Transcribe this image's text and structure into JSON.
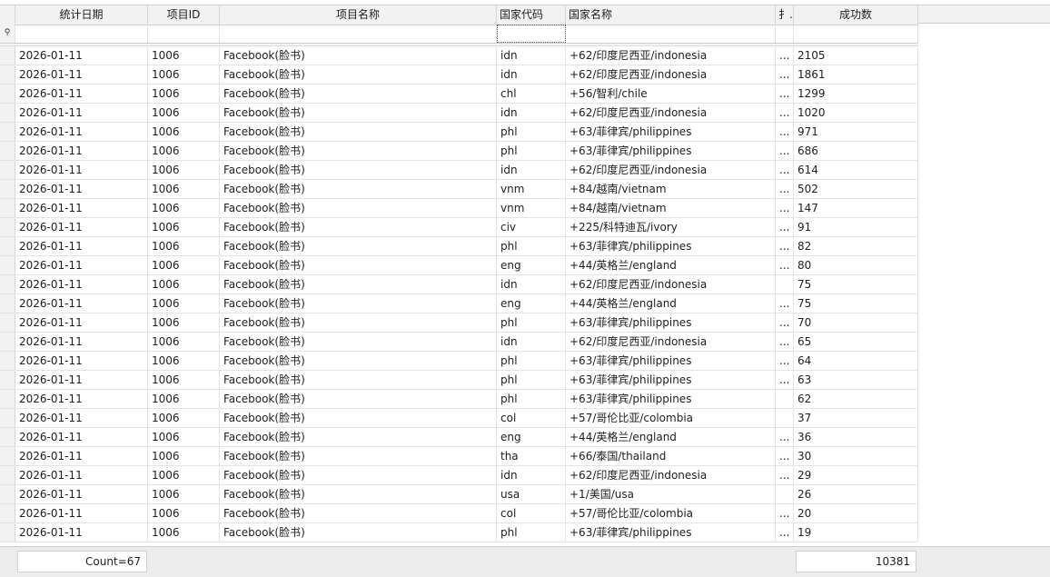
{
  "columns": {
    "date": "统计日期",
    "project_id": "项目ID",
    "project_name": "项目名称",
    "country_code": "国家代码",
    "country_name": "国家名称",
    "truncated": "扌..",
    "success_count": "成功数"
  },
  "filter_row": {
    "indicator": "⚲"
  },
  "rows": [
    {
      "date": "2026-01-11",
      "pid": "1006",
      "name": "Facebook(脸书)",
      "code": "idn",
      "cname": "+62/印度尼西亚/indonesia",
      "t": "...",
      "count": "2105"
    },
    {
      "date": "2026-01-11",
      "pid": "1006",
      "name": "Facebook(脸书)",
      "code": "idn",
      "cname": "+62/印度尼西亚/indonesia",
      "t": "...",
      "count": "1861"
    },
    {
      "date": "2026-01-11",
      "pid": "1006",
      "name": "Facebook(脸书)",
      "code": "chl",
      "cname": "+56/智利/chile",
      "t": "...",
      "count": "1299"
    },
    {
      "date": "2026-01-11",
      "pid": "1006",
      "name": "Facebook(脸书)",
      "code": "idn",
      "cname": "+62/印度尼西亚/indonesia",
      "t": "...",
      "count": "1020"
    },
    {
      "date": "2026-01-11",
      "pid": "1006",
      "name": "Facebook(脸书)",
      "code": "phl",
      "cname": "+63/菲律宾/philippines",
      "t": "...",
      "count": "971"
    },
    {
      "date": "2026-01-11",
      "pid": "1006",
      "name": "Facebook(脸书)",
      "code": "phl",
      "cname": "+63/菲律宾/philippines",
      "t": "...",
      "count": "686"
    },
    {
      "date": "2026-01-11",
      "pid": "1006",
      "name": "Facebook(脸书)",
      "code": "idn",
      "cname": "+62/印度尼西亚/indonesia",
      "t": "...",
      "count": "614"
    },
    {
      "date": "2026-01-11",
      "pid": "1006",
      "name": "Facebook(脸书)",
      "code": "vnm",
      "cname": "+84/越南/vietnam",
      "t": "...",
      "count": "502"
    },
    {
      "date": "2026-01-11",
      "pid": "1006",
      "name": "Facebook(脸书)",
      "code": "vnm",
      "cname": "+84/越南/vietnam",
      "t": "...",
      "count": "147"
    },
    {
      "date": "2026-01-11",
      "pid": "1006",
      "name": "Facebook(脸书)",
      "code": "civ",
      "cname": "+225/科特迪瓦/ivory",
      "t": "...",
      "count": "91"
    },
    {
      "date": "2026-01-11",
      "pid": "1006",
      "name": "Facebook(脸书)",
      "code": "phl",
      "cname": "+63/菲律宾/philippines",
      "t": "...",
      "count": "82"
    },
    {
      "date": "2026-01-11",
      "pid": "1006",
      "name": "Facebook(脸书)",
      "code": "eng",
      "cname": "+44/英格兰/england",
      "t": "...",
      "count": "80"
    },
    {
      "date": "2026-01-11",
      "pid": "1006",
      "name": "Facebook(脸书)",
      "code": "idn",
      "cname": "+62/印度尼西亚/indonesia",
      "t": "",
      "count": "75"
    },
    {
      "date": "2026-01-11",
      "pid": "1006",
      "name": "Facebook(脸书)",
      "code": "eng",
      "cname": "+44/英格兰/england",
      "t": "...",
      "count": "75"
    },
    {
      "date": "2026-01-11",
      "pid": "1006",
      "name": "Facebook(脸书)",
      "code": "phl",
      "cname": "+63/菲律宾/philippines",
      "t": "...",
      "count": "70"
    },
    {
      "date": "2026-01-11",
      "pid": "1006",
      "name": "Facebook(脸书)",
      "code": "idn",
      "cname": "+62/印度尼西亚/indonesia",
      "t": "...",
      "count": "65"
    },
    {
      "date": "2026-01-11",
      "pid": "1006",
      "name": "Facebook(脸书)",
      "code": "phl",
      "cname": "+63/菲律宾/philippines",
      "t": "...",
      "count": "64"
    },
    {
      "date": "2026-01-11",
      "pid": "1006",
      "name": "Facebook(脸书)",
      "code": "phl",
      "cname": "+63/菲律宾/philippines",
      "t": "...",
      "count": "63"
    },
    {
      "date": "2026-01-11",
      "pid": "1006",
      "name": "Facebook(脸书)",
      "code": "phl",
      "cname": "+63/菲律宾/philippines",
      "t": "",
      "count": "62"
    },
    {
      "date": "2026-01-11",
      "pid": "1006",
      "name": "Facebook(脸书)",
      "code": "col",
      "cname": "+57/哥伦比亚/colombia",
      "t": "",
      "count": "37"
    },
    {
      "date": "2026-01-11",
      "pid": "1006",
      "name": "Facebook(脸书)",
      "code": "eng",
      "cname": "+44/英格兰/england",
      "t": "...",
      "count": "36"
    },
    {
      "date": "2026-01-11",
      "pid": "1006",
      "name": "Facebook(脸书)",
      "code": "tha",
      "cname": "+66/泰国/thailand",
      "t": "...",
      "count": "30"
    },
    {
      "date": "2026-01-11",
      "pid": "1006",
      "name": "Facebook(脸书)",
      "code": "idn",
      "cname": "+62/印度尼西亚/indonesia",
      "t": "...",
      "count": "29"
    },
    {
      "date": "2026-01-11",
      "pid": "1006",
      "name": "Facebook(脸书)",
      "code": "usa",
      "cname": "+1/美国/usa",
      "t": "",
      "count": "26"
    },
    {
      "date": "2026-01-11",
      "pid": "1006",
      "name": "Facebook(脸书)",
      "code": "col",
      "cname": "+57/哥伦比亚/colombia",
      "t": "...",
      "count": "20"
    },
    {
      "date": "2026-01-11",
      "pid": "1006",
      "name": "Facebook(脸书)",
      "code": "phl",
      "cname": "+63/菲律宾/philippines",
      "t": "...",
      "count": "19"
    }
  ],
  "footer": {
    "count_label": "Count=67",
    "sum_label": "10381"
  }
}
